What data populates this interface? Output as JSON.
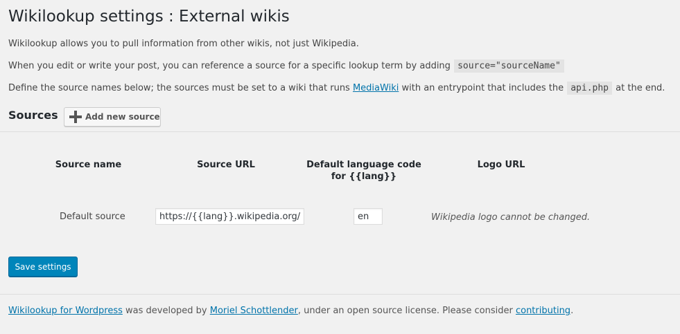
{
  "page": {
    "title": "Wikilookup settings : External wikis"
  },
  "intro": {
    "p1": "Wikilookup allows you to pull information from other wikis, not just Wikipedia.",
    "p2_text": "When you edit or write your post, you can reference a source for a specific lookup term by adding",
    "p2_code": "source=\"sourceName\"",
    "p3_before": "Define the source names below; the sources must be set to a wiki that runs",
    "p3_link": "MediaWiki",
    "p3_middle": "with an entrypoint that includes the",
    "p3_code": "api.php",
    "p3_after": "at the end."
  },
  "sources": {
    "heading": "Sources",
    "add_button_label": "Add new source",
    "add_button_icon": "plus-icon",
    "columns": {
      "name": "Source name",
      "url": "Source URL",
      "lang_line1": "Default language code",
      "lang_line2": "for {{lang}}",
      "logo": "Logo URL"
    },
    "rows": [
      {
        "name": "Default source",
        "url": "https://{{lang}}.wikipedia.org/w/api.php",
        "lang": "en",
        "logo_note": "Wikipedia logo cannot be changed."
      }
    ]
  },
  "actions": {
    "save_label": "Save settings"
  },
  "footer": {
    "link1": "Wikilookup for Wordpress",
    "text1": "was developed by",
    "link2": "Moriel Schottlender",
    "text2": ", under an open source license. Please consider",
    "link3": "contributing",
    "text3": "."
  },
  "colors": {
    "background": "#f1f1f1",
    "primary_button": "#0085ba",
    "link": "#0073aa"
  }
}
